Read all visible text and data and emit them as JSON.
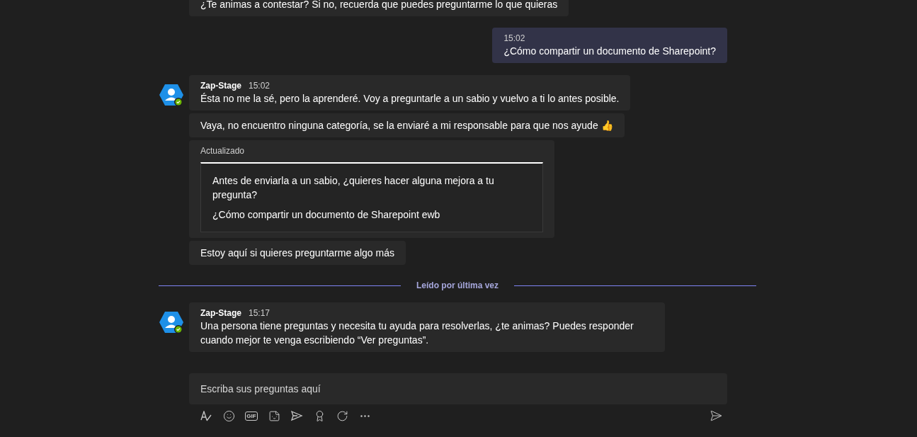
{
  "messages": [
    {
      "kind": "bot_text",
      "text": "¿Te animas a contestar? Si no, recuerda que puedes preguntarme lo que quieras"
    },
    {
      "kind": "own",
      "time": "15:02",
      "text": "¿Cómo compartir un documento de Sharepoint?"
    },
    {
      "kind": "bot_header",
      "author": "Zap-Stage",
      "time": "15:02",
      "text": "Ésta no me la sé, pero la aprenderé. Voy a preguntarle a un sabio y vuelvo a ti lo antes posible."
    },
    {
      "kind": "bot_text",
      "text": "Vaya, no encuentro ninguna categoría, se la enviaré a mi responsable para que nos ayude 👍"
    },
    {
      "kind": "bot_card",
      "label": "Actualizado",
      "card_title": "Antes de enviarla a un sabio, ¿quieres hacer alguna mejora a tu pregunta?",
      "card_body": "¿Cómo compartir un documento de Sharepoint ewb"
    },
    {
      "kind": "bot_text",
      "text": "Estoy aquí si quieres preguntarme algo más"
    },
    {
      "kind": "divider",
      "text": "Leído por última vez"
    },
    {
      "kind": "bot_header",
      "author": "Zap-Stage",
      "time": "15:17",
      "text": "Una persona tiene preguntas y necesita tu ayuda para resolverlas, ¿te animas? Puedes responder cuando mejor te venga escribiendo “Ver preguntas”."
    }
  ],
  "composer": {
    "placeholder": "Escriba sus preguntas aquí"
  },
  "toolbar": [
    {
      "kind": "format"
    },
    {
      "kind": "emoji"
    },
    {
      "kind": "gif",
      "label": "GIF"
    },
    {
      "kind": "sticker"
    },
    {
      "kind": "meet"
    },
    {
      "kind": "praise"
    },
    {
      "kind": "loop"
    },
    {
      "kind": "more"
    }
  ]
}
